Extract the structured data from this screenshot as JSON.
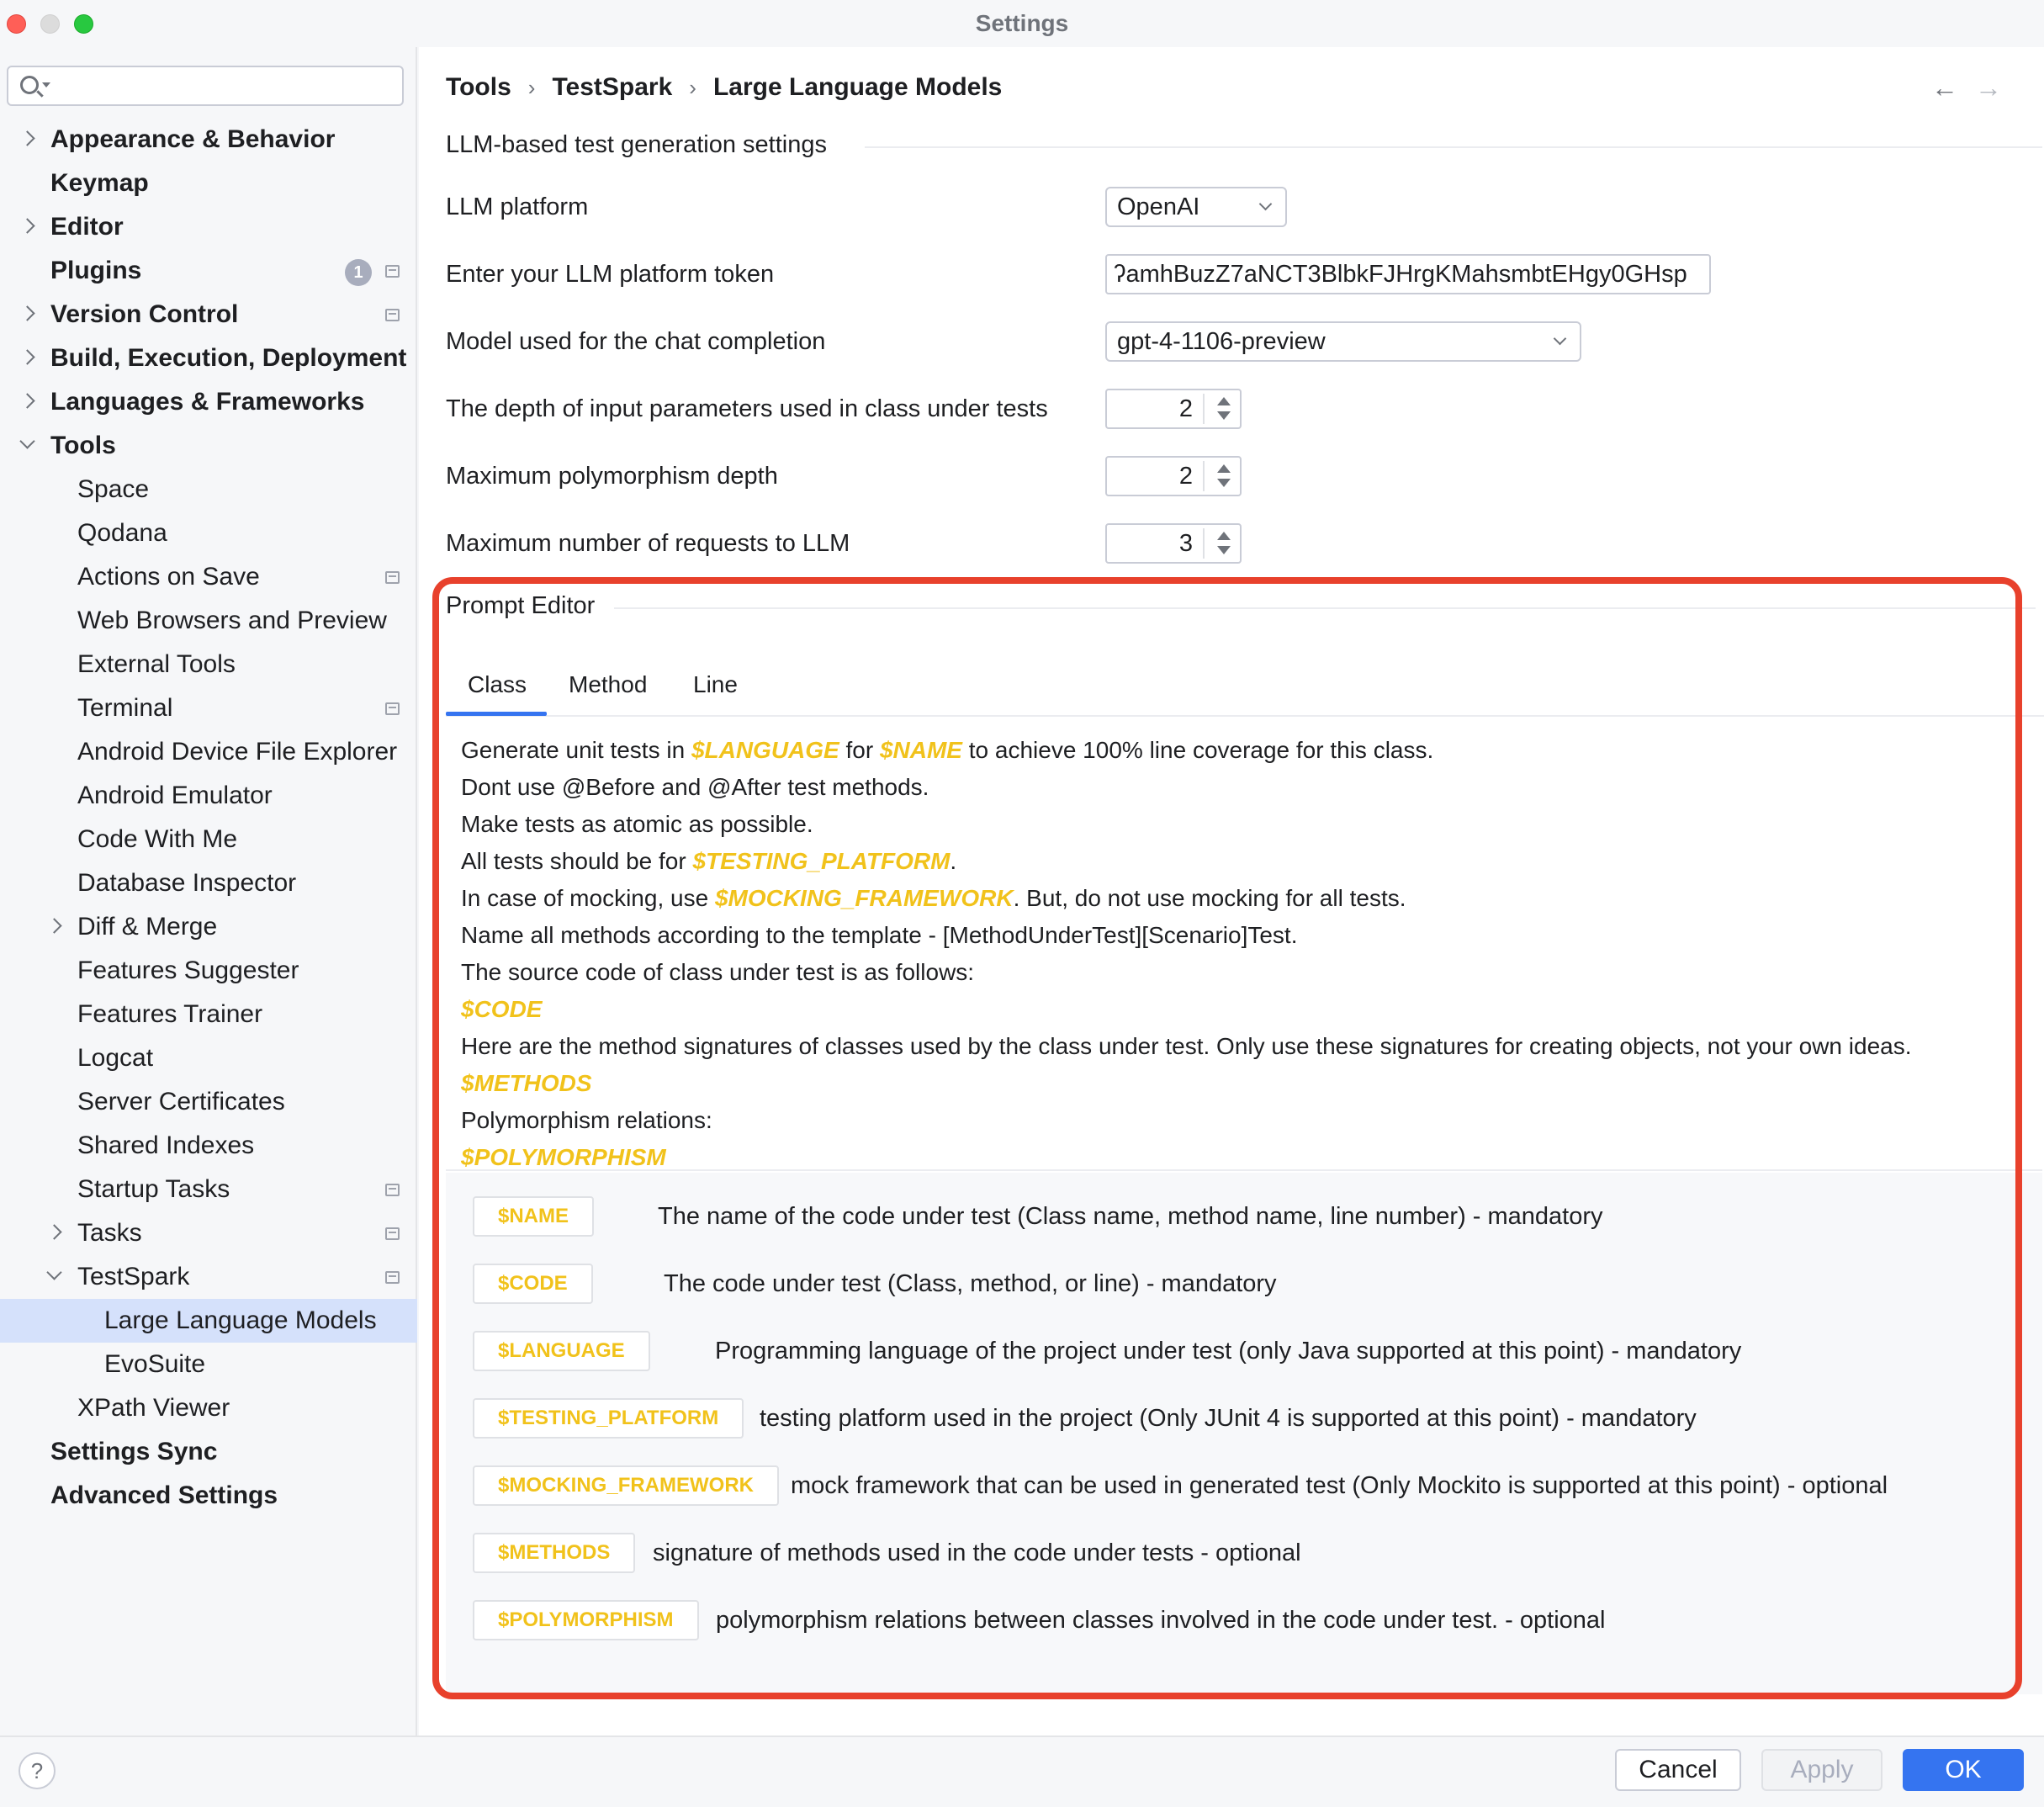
{
  "window": {
    "title": "Settings"
  },
  "search": {
    "placeholder": ""
  },
  "sidebar": {
    "items": [
      {
        "label": "Appearance & Behavior",
        "bold": true,
        "chevron": "right"
      },
      {
        "label": "Keymap",
        "bold": true
      },
      {
        "label": "Editor",
        "bold": true,
        "chevron": "right"
      },
      {
        "label": "Plugins",
        "bold": true,
        "badge": "1",
        "project_icon": true
      },
      {
        "label": "Version Control",
        "bold": true,
        "chevron": "right",
        "project_icon": true
      },
      {
        "label": "Build, Execution, Deployment",
        "bold": true,
        "chevron": "right"
      },
      {
        "label": "Languages & Frameworks",
        "bold": true,
        "chevron": "right"
      },
      {
        "label": "Tools",
        "bold": true,
        "chevron": "down"
      },
      {
        "label": "Space"
      },
      {
        "label": "Qodana"
      },
      {
        "label": "Actions on Save",
        "project_icon": true
      },
      {
        "label": "Web Browsers and Preview"
      },
      {
        "label": "External Tools"
      },
      {
        "label": "Terminal",
        "project_icon": true
      },
      {
        "label": "Android Device File Explorer"
      },
      {
        "label": "Android Emulator"
      },
      {
        "label": "Code With Me"
      },
      {
        "label": "Database Inspector"
      },
      {
        "label": "Diff & Merge",
        "chevron": "right"
      },
      {
        "label": "Features Suggester"
      },
      {
        "label": "Features Trainer"
      },
      {
        "label": "Logcat"
      },
      {
        "label": "Server Certificates"
      },
      {
        "label": "Shared Indexes"
      },
      {
        "label": "Startup Tasks",
        "project_icon": true
      },
      {
        "label": "Tasks",
        "chevron": "right",
        "project_icon": true
      },
      {
        "label": "TestSpark",
        "chevron": "down",
        "project_icon": true
      },
      {
        "label": "Large Language Models",
        "selected": true
      },
      {
        "label": "EvoSuite"
      },
      {
        "label": "XPath Viewer"
      },
      {
        "label": "Settings Sync",
        "bold": true
      },
      {
        "label": "Advanced Settings",
        "bold": true
      }
    ]
  },
  "breadcrumb": {
    "part1": "Tools",
    "part2": "TestSpark",
    "part3": "Large Language Models",
    "sep": "›"
  },
  "nav": {
    "back": "←",
    "forward": "→"
  },
  "llm_settings": {
    "section_title": "LLM-based test generation settings",
    "platform_label": "LLM platform",
    "platform_value": "OpenAI",
    "token_label": "Enter your LLM platform token",
    "token_value": "ʔamhBuzZ7aNCT3BlbkFJHrgKMahsmbtEHgy0GHsp",
    "model_label": "Model used for the chat completion",
    "model_value": "gpt-4-1106-preview",
    "depth_label": "The depth of input parameters used in class under tests",
    "depth_value": "2",
    "poly_label": "Maximum polymorphism depth",
    "poly_value": "2",
    "requests_label": "Maximum number of requests to LLM",
    "requests_value": "3"
  },
  "prompt_editor": {
    "section_title": "Prompt Editor",
    "tabs": [
      "Class",
      "Method",
      "Line"
    ],
    "selected_tab": "Class",
    "lines": [
      [
        {
          "t": "Generate unit tests in "
        },
        {
          "t": "$LANGUAGE",
          "kw": true
        },
        {
          "t": " for "
        },
        {
          "t": "$NAME",
          "kw": true
        },
        {
          "t": " to achieve 100% line coverage for this class."
        }
      ],
      [
        {
          "t": "Dont use @Before and @After test methods."
        }
      ],
      [
        {
          "t": "Make tests as atomic as possible."
        }
      ],
      [
        {
          "t": "All tests should be for "
        },
        {
          "t": "$TESTING_PLATFORM",
          "kw": true
        },
        {
          "t": "."
        }
      ],
      [
        {
          "t": "In case of mocking, use "
        },
        {
          "t": "$MOCKING_FRAMEWORK",
          "kw": true
        },
        {
          "t": ". But, do not use mocking for all tests."
        }
      ],
      [
        {
          "t": "Name all methods according to the template - [MethodUnderTest][Scenario]Test."
        }
      ],
      [
        {
          "t": "The source code of class under test is as follows:"
        }
      ],
      [
        {
          "t": "$CODE",
          "kw": true
        }
      ],
      [
        {
          "t": "Here are the method signatures of classes used by the class under test. Only use these signatures for creating objects, not your own ideas."
        }
      ],
      [
        {
          "t": "$METHODS",
          "kw": true
        }
      ],
      [
        {
          "t": "Polymorphism relations:"
        }
      ],
      [
        {
          "t": "$POLYMORPHISM",
          "kw": true
        }
      ]
    ],
    "legend": [
      {
        "chip": "$NAME",
        "desc": "The name of the code under test (Class name, method name, line number) - mandatory"
      },
      {
        "chip": "$CODE",
        "desc": "The code under test (Class, method, or line) - mandatory"
      },
      {
        "chip": "$LANGUAGE",
        "desc": "Programming language of the project under test (only Java supported at this point) - mandatory"
      },
      {
        "chip": "$TESTING_PLATFORM",
        "desc": "testing platform used in the project (Only JUnit 4 is supported at this point) - mandatory"
      },
      {
        "chip": "$MOCKING_FRAMEWORK",
        "desc": "mock framework that can be used in generated test (Only Mockito is supported at this point) - optional"
      },
      {
        "chip": "$METHODS",
        "desc": "signature of methods used in the code under tests - optional"
      },
      {
        "chip": "$POLYMORPHISM",
        "desc": "polymorphism relations between classes involved in the code under test. - optional"
      }
    ]
  },
  "footer": {
    "help": "?",
    "cancel": "Cancel",
    "apply": "Apply",
    "ok": "OK"
  },
  "colors": {
    "accent": "#3574f0",
    "keyword": "#f1c21b",
    "highlight_border": "#e8412c",
    "selected_bg": "#d5e1fb"
  }
}
